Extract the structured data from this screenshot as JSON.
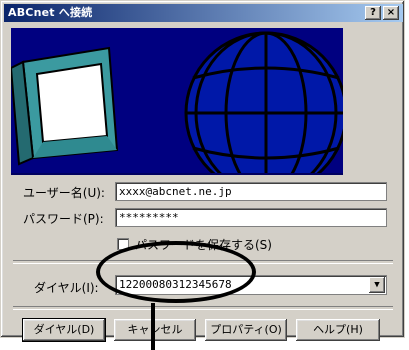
{
  "window": {
    "title": "ABCnet へ接続",
    "help_button": "?",
    "close_button": "×"
  },
  "form": {
    "username_label": "ユーザー名(U):",
    "username_value": "xxxx@abcnet.ne.jp",
    "password_label": "パスワード(P):",
    "password_value": "*********",
    "save_password_label": "パスワードを保存する(S)",
    "dial_label": "ダイヤル(I):",
    "dial_value": "12200080312345678"
  },
  "buttons": {
    "dial": "ダイヤル(D)",
    "cancel": "キャンセル",
    "properties": "プロパティ(O)",
    "help": "ヘルプ(H)"
  },
  "icons": {
    "computer": "computer-monitor-icon",
    "globe": "globe-icon",
    "dropdown": "chevron-down-icon"
  },
  "colors": {
    "titlebar_start": "#0a246a",
    "titlebar_end": "#a6caf0",
    "banner_bg": "#000080",
    "dialog_bg": "#d4d0c8"
  }
}
